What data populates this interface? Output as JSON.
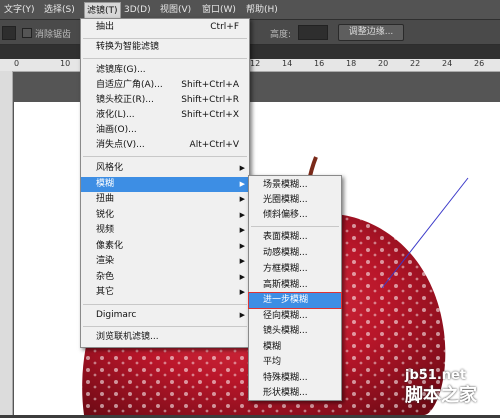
{
  "menubar": {
    "items": [
      {
        "label": "文字(Y)"
      },
      {
        "label": "选择(S)"
      },
      {
        "label": "滤镜(T)"
      },
      {
        "label": "3D(D)"
      },
      {
        "label": "视图(V)"
      },
      {
        "label": "窗口(W)"
      },
      {
        "label": "帮助(H)"
      }
    ]
  },
  "options_bar": {
    "antialias_label": "消除锯齿",
    "height_label": "高度:",
    "refine_edge_button": "调整边缘..."
  },
  "ruler": {
    "numbers": [
      "0",
      "10",
      "12",
      "14",
      "16",
      "18",
      "20",
      "22",
      "24",
      "26"
    ]
  },
  "filter_menu": {
    "items": [
      {
        "label": "抽出",
        "shortcut": "Ctrl+F"
      },
      {
        "label": "转换为智能滤镜",
        "shortcut": ""
      },
      {
        "label": "滤镜库(G)...",
        "shortcut": ""
      },
      {
        "label": "自适应广角(A)...",
        "shortcut": "Shift+Ctrl+A"
      },
      {
        "label": "镜头校正(R)...",
        "shortcut": "Shift+Ctrl+R"
      },
      {
        "label": "液化(L)...",
        "shortcut": "Shift+Ctrl+X"
      },
      {
        "label": "油画(O)...",
        "shortcut": ""
      },
      {
        "label": "消失点(V)...",
        "shortcut": "Alt+Ctrl+V"
      },
      {
        "label": "风格化",
        "shortcut": ""
      },
      {
        "label": "模糊",
        "shortcut": ""
      },
      {
        "label": "扭曲",
        "shortcut": ""
      },
      {
        "label": "锐化",
        "shortcut": ""
      },
      {
        "label": "视频",
        "shortcut": ""
      },
      {
        "label": "像素化",
        "shortcut": ""
      },
      {
        "label": "渲染",
        "shortcut": ""
      },
      {
        "label": "杂色",
        "shortcut": ""
      },
      {
        "label": "其它",
        "shortcut": ""
      },
      {
        "label": "Digimarc",
        "shortcut": ""
      },
      {
        "label": "浏览联机滤镜...",
        "shortcut": ""
      }
    ]
  },
  "blur_menu": {
    "items": [
      {
        "label": "场景模糊..."
      },
      {
        "label": "光圈模糊..."
      },
      {
        "label": "倾斜偏移..."
      },
      {
        "label": "表面模糊..."
      },
      {
        "label": "动感模糊..."
      },
      {
        "label": "方框模糊..."
      },
      {
        "label": "高斯模糊..."
      },
      {
        "label": "进一步模糊"
      },
      {
        "label": "径向模糊..."
      },
      {
        "label": "镜头模糊..."
      },
      {
        "label": "模糊"
      },
      {
        "label": "平均"
      },
      {
        "label": "特殊模糊..."
      },
      {
        "label": "形状模糊..."
      }
    ]
  },
  "watermark": {
    "site": "jb51.net",
    "name": "脚本之家"
  },
  "colors": {
    "highlight": "#3d8ee4",
    "apple_red": "#c0182a"
  }
}
